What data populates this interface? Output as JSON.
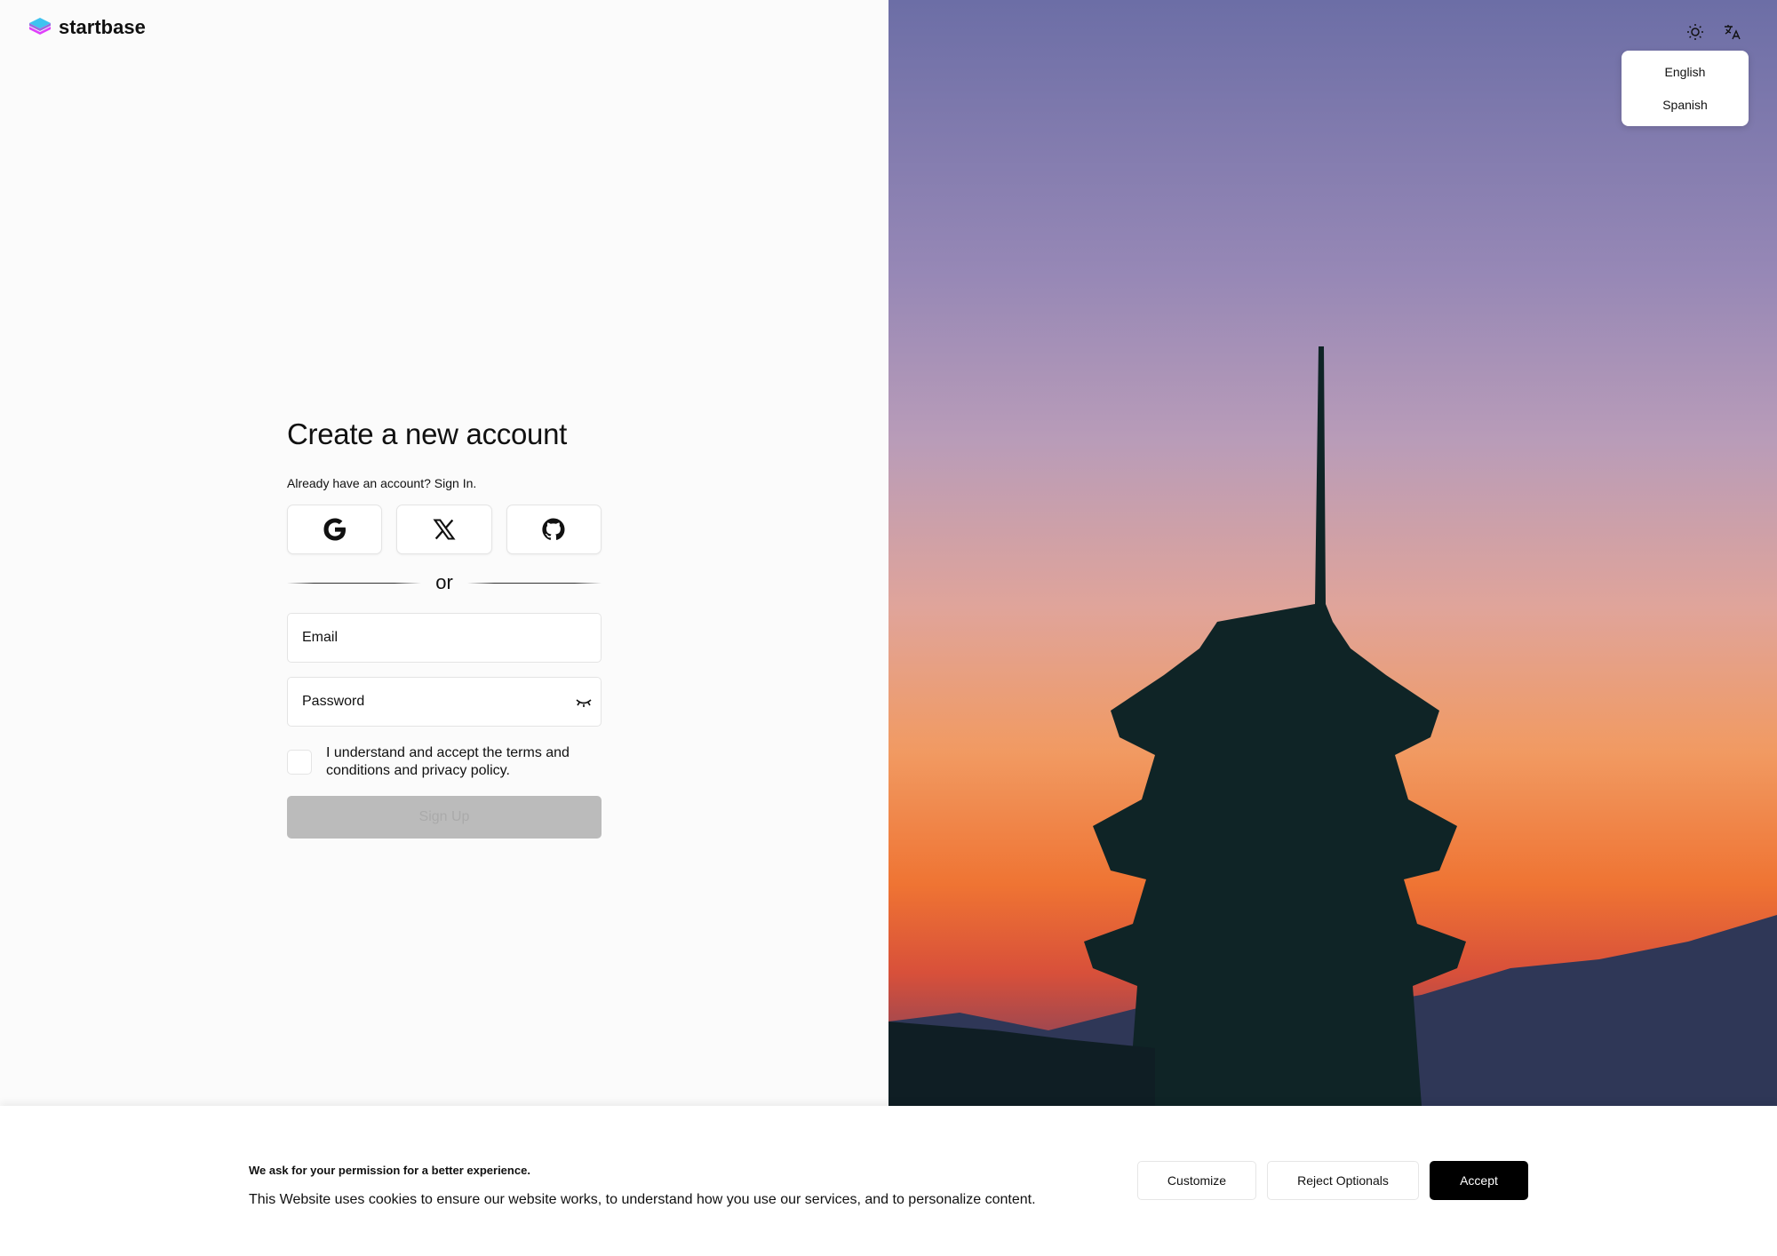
{
  "brand": {
    "name": "startbase"
  },
  "form": {
    "title": "Create a new account",
    "signin_prompt": "Already have an account? Sign In.",
    "social": [
      {
        "icon": "google-icon"
      },
      {
        "icon": "x-icon"
      },
      {
        "icon": "github-icon"
      }
    ],
    "divider": "or",
    "email_placeholder": "Email",
    "password_placeholder": "Password",
    "terms_label": "I understand and accept the terms and conditions and privacy policy.",
    "terms_checked": false,
    "signup_label": "Sign Up"
  },
  "topbar": {
    "theme_icon": "sun-icon",
    "language_icon": "translate-icon"
  },
  "language_menu": {
    "items": [
      "English",
      "Spanish"
    ]
  },
  "cookie": {
    "title": "We ask for your permission for a better experience.",
    "text": "This Website uses cookies to ensure our website works, to understand how you use our services, and to personalize content.",
    "customize": "Customize",
    "reject": "Reject Optionals",
    "accept": "Accept"
  },
  "colors": {
    "accent_button": "#000000",
    "signup_disabled": "#bbbbbb"
  }
}
